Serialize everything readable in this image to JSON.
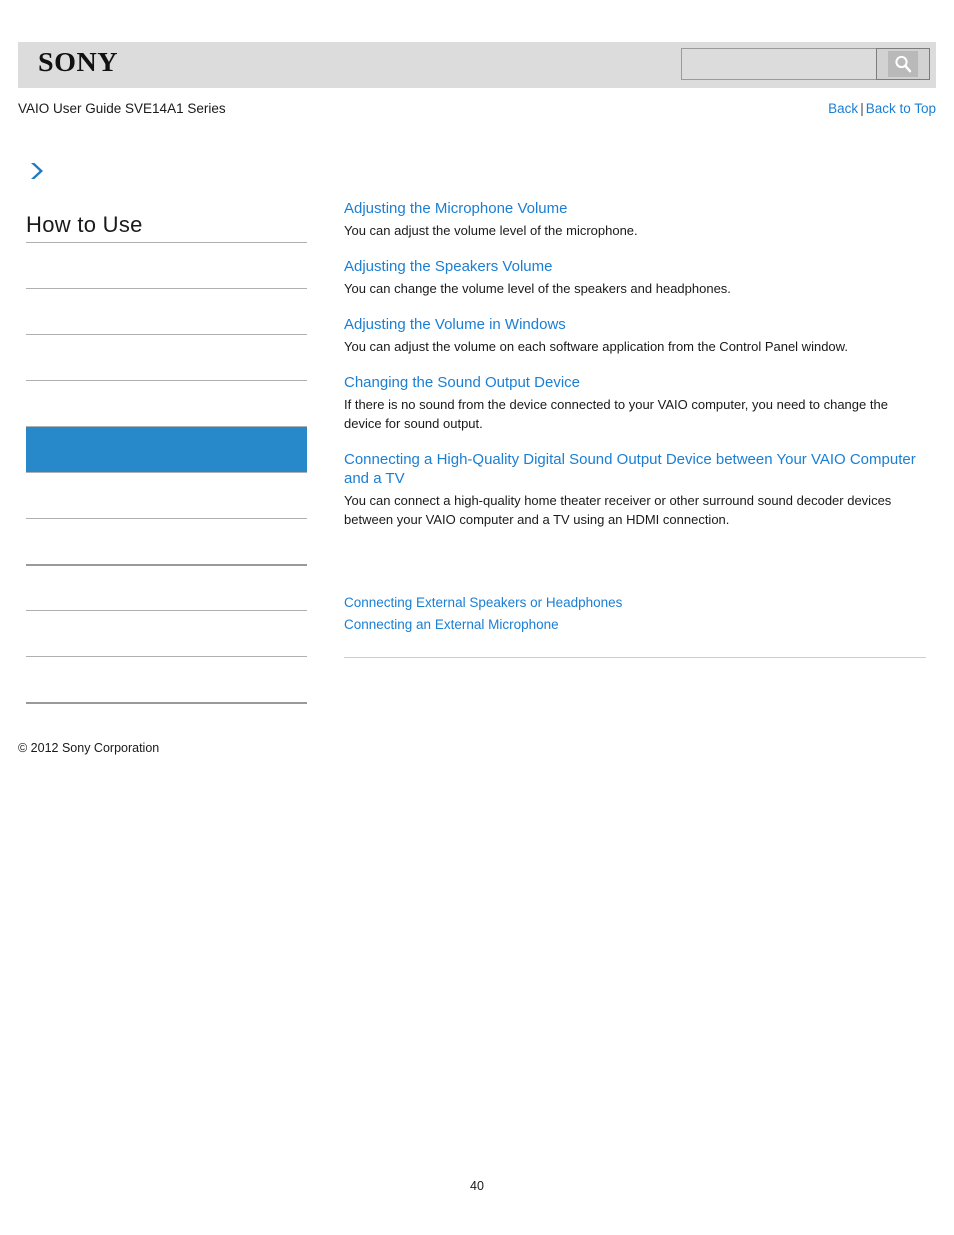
{
  "header": {
    "logo_text": "SONY",
    "search": {
      "value": "",
      "placeholder": "",
      "button_icon": "search-icon"
    }
  },
  "breadcrumb": {
    "title": "VAIO User Guide SVE14A1 Series",
    "back_label": "Back",
    "separator": "|",
    "back_to_top_label": "Back to Top"
  },
  "sidebar": {
    "arrow_icon": "chevron-right-icon",
    "heading": "How to Use",
    "items": [
      {
        "label": "",
        "selected": false
      },
      {
        "label": "",
        "selected": false
      },
      {
        "label": "",
        "selected": false
      },
      {
        "label": "",
        "selected": false
      },
      {
        "label": "",
        "selected": true
      },
      {
        "label": "",
        "selected": false
      },
      {
        "label": "",
        "selected": false
      },
      {
        "label": "",
        "selected": false
      },
      {
        "label": "",
        "selected": false
      },
      {
        "label": "",
        "selected": false
      }
    ],
    "selected_color": "#2789c9"
  },
  "content": {
    "entries": [
      {
        "title": "Adjusting the Microphone Volume",
        "description": "You can adjust the volume level of the microphone."
      },
      {
        "title": "Adjusting the Speakers Volume",
        "description": "You can change the volume level of the speakers and headphones."
      },
      {
        "title": "Adjusting the Volume in Windows",
        "description": "You can adjust the volume on each software application from the Control Panel window."
      },
      {
        "title": "Changing the Sound Output Device",
        "description": "If there is no sound from the device connected to your VAIO computer, you need to change the device for sound output."
      },
      {
        "title": "Connecting a High-Quality Digital Sound Output Device between Your VAIO Computer and a TV",
        "description": "You can connect a high-quality home theater receiver or other surround sound decoder devices between your VAIO computer and a TV using an HDMI connection."
      }
    ],
    "related_links": [
      "Connecting External Speakers or Headphones",
      "Connecting an External Microphone"
    ]
  },
  "footer": {
    "copyright": "© 2012 Sony Corporation",
    "page_number": "40"
  },
  "colors": {
    "link": "#1a7fd4",
    "header_band": "#dcdcdc",
    "accent": "#2789c9"
  }
}
